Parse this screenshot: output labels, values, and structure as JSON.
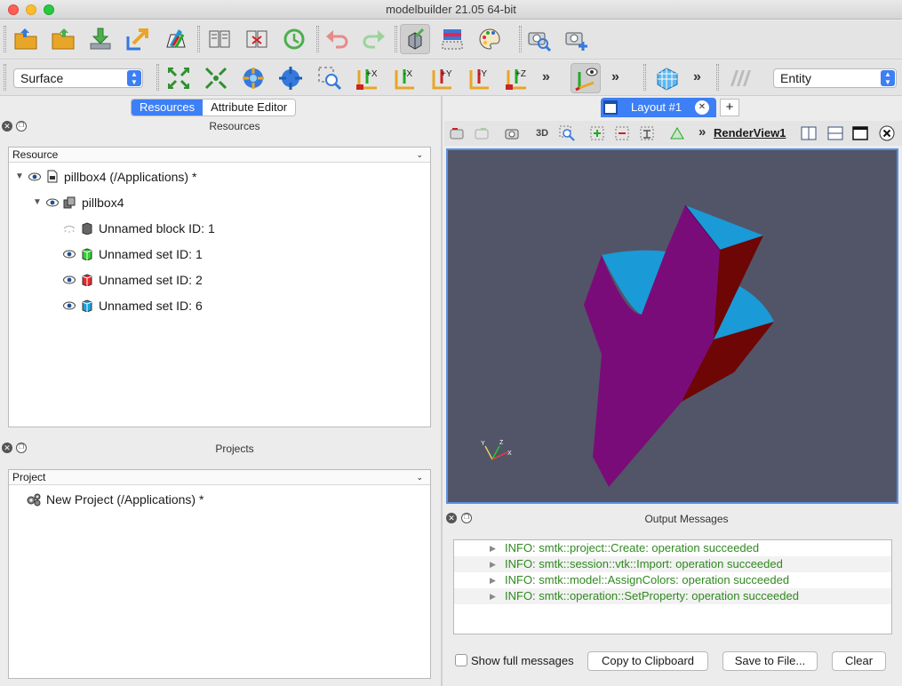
{
  "window": {
    "title": "modelbuilder 21.05 64-bit"
  },
  "toolbar": {
    "representation": "Surface",
    "selection_mode": "Entity"
  },
  "tabs": [
    {
      "label": "Resources",
      "selected": true
    },
    {
      "label": "Attribute Editor",
      "selected": false
    }
  ],
  "resources_dock": {
    "title": "Resources",
    "header": "Resource",
    "items": [
      {
        "label": "pillbox4 (/Applications) *",
        "level": 0,
        "icon": "document-icon",
        "visible": true
      },
      {
        "label": "pillbox4",
        "level": 1,
        "icon": "model-icon",
        "visible": true
      },
      {
        "label": "Unnamed block ID: 1",
        "level": 2,
        "icon": "block-icon",
        "color": "#666666",
        "visible": false
      },
      {
        "label": "Unnamed set ID: 1",
        "level": 2,
        "icon": "set-icon",
        "color": "#2fd12f",
        "visible": true
      },
      {
        "label": "Unnamed set ID: 2",
        "level": 2,
        "icon": "set-icon",
        "color": "#e8282a",
        "visible": true
      },
      {
        "label": "Unnamed set ID: 6",
        "level": 2,
        "icon": "set-icon",
        "color": "#19a0e0",
        "visible": true
      }
    ]
  },
  "projects_dock": {
    "title": "Projects",
    "header": "Project",
    "items": [
      {
        "label": "New Project (/Applications) *",
        "icon": "gears-icon"
      }
    ]
  },
  "layout": {
    "tab_label": "Layout #1",
    "add_tab": "+",
    "render_view": "RenderView1",
    "view_3d_label": "3D"
  },
  "colors": {
    "viewport_bg": "#525568",
    "face_purple": "#7a0c7a",
    "face_maroon": "#6e0606",
    "face_cyan": "#1a9ad6",
    "accent": "#3d7ff5"
  },
  "output": {
    "title": "Output Messages",
    "messages": [
      "INFO: smtk::project::Create: operation succeeded",
      "INFO: smtk::session::vtk::Import: operation succeeded",
      "INFO: smtk::model::AssignColors: operation succeeded",
      "INFO: smtk::operation::SetProperty: operation succeeded"
    ],
    "show_full_label": "Show full messages",
    "copy_label": "Copy to Clipboard",
    "save_label": "Save to File...",
    "clear_label": "Clear"
  }
}
